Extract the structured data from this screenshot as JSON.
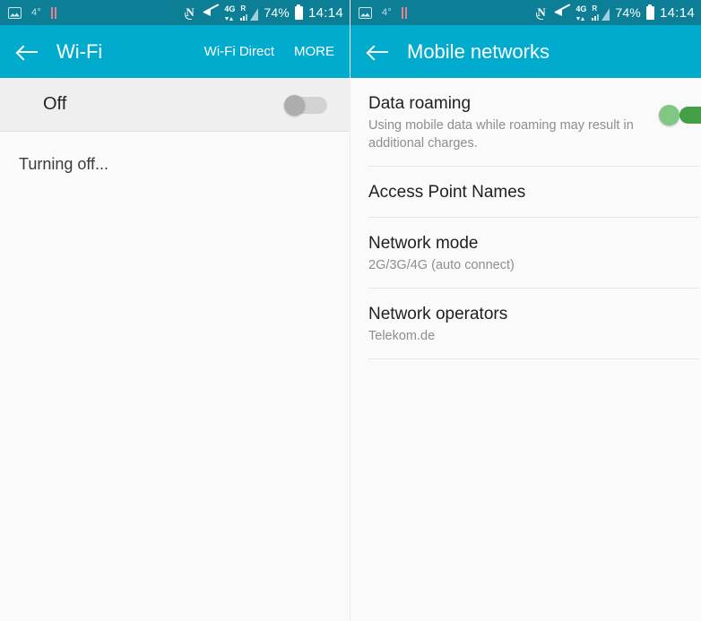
{
  "status_bar": {
    "left_icons": [
      {
        "name": "photo-icon",
        "glyph": "image"
      },
      {
        "name": "temperature-indicator",
        "text": "4°"
      },
      {
        "name": "pause-icon",
        "glyph": "pause"
      }
    ],
    "right_icons": [
      {
        "name": "nfc-icon",
        "text": "N"
      },
      {
        "name": "sound-muted-icon",
        "glyph": "mute"
      },
      {
        "name": "network-4g-icon",
        "text": "4G"
      },
      {
        "name": "roaming-signal-icon",
        "text": "R"
      }
    ],
    "battery_percent": "74%",
    "time": "14:14"
  },
  "colors": {
    "status_bar_bg": "#0c7e95",
    "app_bar_bg": "#00abcd",
    "page_bg": "#fafafa",
    "toggle_row_bg": "#efefef",
    "switch_on_track": "#43a047",
    "switch_on_knob": "#81c784",
    "switch_off_track": "#d2d2d2",
    "switch_off_knob": "#adadad",
    "primary_text": "#1f1f1f",
    "secondary_text": "#8e8e8e"
  },
  "left_screen": {
    "app_bar": {
      "back_icon": "back-arrow-icon",
      "title": "Wi-Fi",
      "action_direct": "Wi-Fi Direct",
      "action_more": "MORE"
    },
    "toggle_row": {
      "label": "Off",
      "switch_state": "off"
    },
    "status_message": "Turning off..."
  },
  "right_screen": {
    "app_bar": {
      "back_icon": "back-arrow-icon",
      "title": "Mobile networks"
    },
    "items": [
      {
        "title": "Data roaming",
        "subtitle": "Using mobile data while roaming may result in additional charges.",
        "has_switch": true,
        "switch_state": "on"
      },
      {
        "title": "Access Point Names",
        "subtitle": "",
        "has_switch": false
      },
      {
        "title": "Network mode",
        "subtitle": "2G/3G/4G (auto connect)",
        "has_switch": false
      },
      {
        "title": "Network operators",
        "subtitle": "Telekom.de",
        "has_switch": false
      }
    ]
  }
}
